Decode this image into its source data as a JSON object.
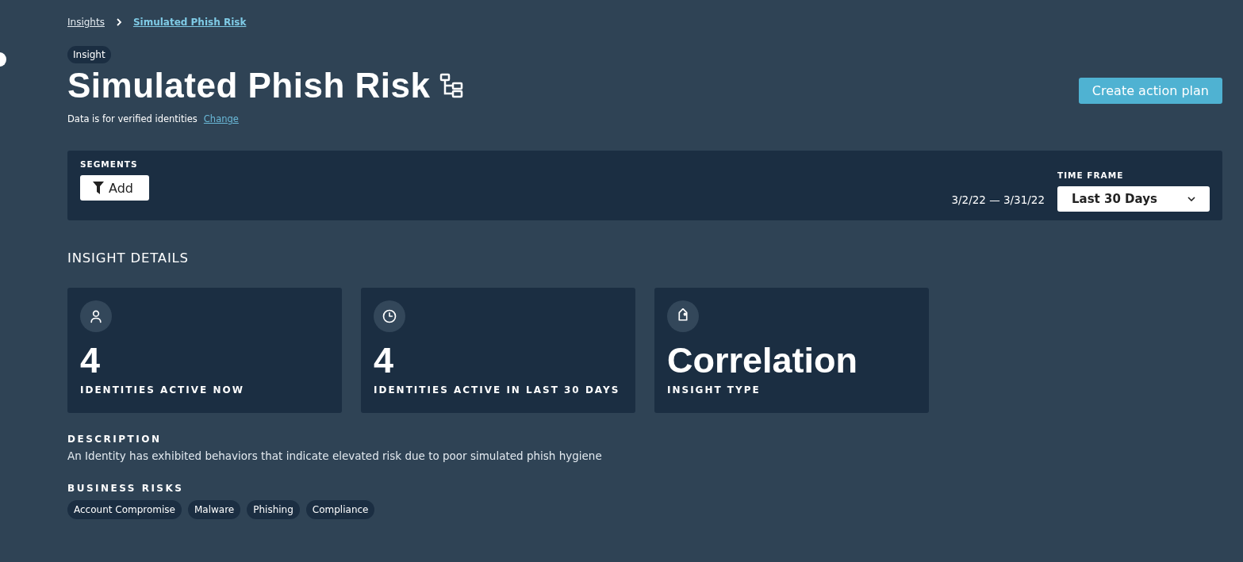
{
  "breadcrumbs": [
    {
      "label": "Insights",
      "selected": false
    },
    {
      "label": "Simulated Phish Risk",
      "selected": true
    }
  ],
  "badge": "Insight",
  "title": "Simulated Phish Risk",
  "data_note": {
    "text": "Data is for verified identities",
    "link": "Change"
  },
  "primary_button": "Create action plan",
  "filters": {
    "segments_label": "SEGMENTS",
    "add_button": "Add",
    "date_range": "3/2/22 — 3/31/22",
    "time_frame_label": "TIME FRAME",
    "time_frame_value": "Last 30 Days"
  },
  "section_title": "INSIGHT DETAILS",
  "cards": [
    {
      "kind": "person",
      "value": "4",
      "label": "IDENTITIES ACTIVE NOW"
    },
    {
      "kind": "clock",
      "value": "4",
      "label": "IDENTITIES ACTIVE IN LAST 30 DAYS"
    },
    {
      "kind": "tag",
      "value": "Correlation",
      "label": "INSIGHT TYPE"
    }
  ],
  "description": {
    "heading": "DESCRIPTION",
    "text": "An Identity has exhibited behaviors that indicate elevated risk due to poor simulated phish hygiene"
  },
  "business_risks": {
    "heading": "BUSINESS RISKS",
    "tags": [
      "Account Compromise",
      "Malware",
      "Phishing",
      "Compliance"
    ]
  }
}
